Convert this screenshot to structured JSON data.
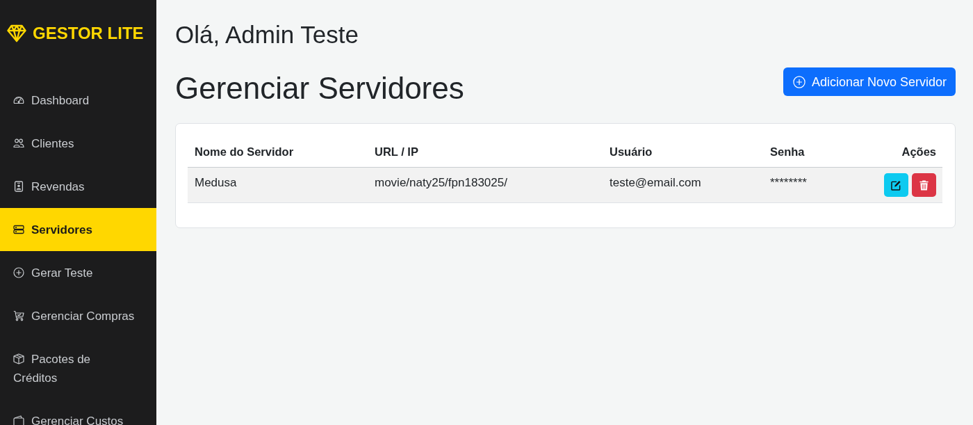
{
  "sidebar": {
    "brand": "GESTOR LITE",
    "items": [
      {
        "label": "Dashboard",
        "selected": false
      },
      {
        "label": "Clientes",
        "selected": false
      },
      {
        "label": "Revendas",
        "selected": false
      },
      {
        "label": "Servidores",
        "selected": true
      },
      {
        "label": "Gerar Teste",
        "selected": false
      },
      {
        "label": "Gerenciar Compras",
        "selected": false
      },
      {
        "label": "Pacotes de Créditos",
        "selected": false
      },
      {
        "label": "Gerenciar Custos",
        "selected": false
      }
    ]
  },
  "header": {
    "greeting": "Olá, Admin Teste",
    "page_title": "Gerenciar Servidores",
    "add_button": "Adicionar Novo Servidor"
  },
  "table": {
    "columns": [
      "Nome do Servidor",
      "URL / IP",
      "Usuário",
      "Senha",
      "Ações"
    ],
    "rows": [
      {
        "cells": [
          "Medusa",
          "movie/naty25/fpn183025/",
          "teste@email.com",
          "********"
        ]
      }
    ]
  }
}
